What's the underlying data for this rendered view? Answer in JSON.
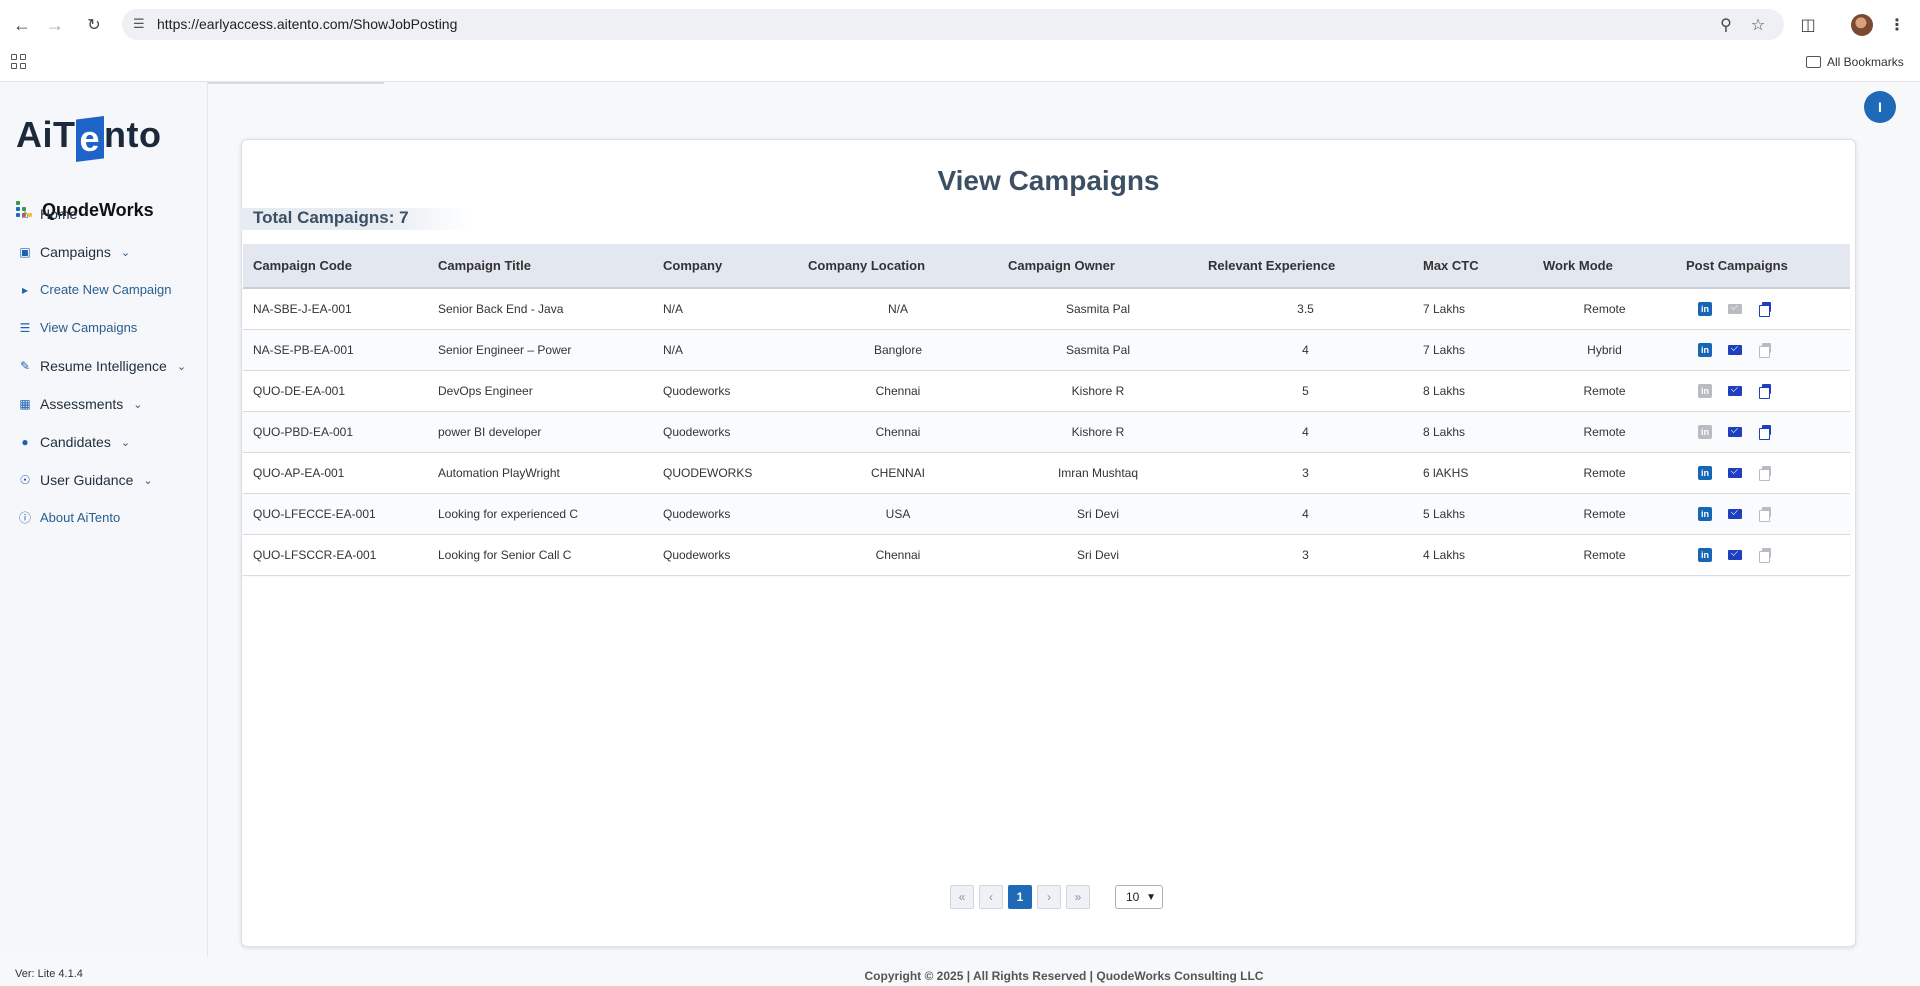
{
  "browser": {
    "url": "https://earlyaccess.aitento.com/ShowJobPosting",
    "bookmarks_label": "All Bookmarks"
  },
  "sidebar": {
    "brand_ai": "AiT",
    "brand_t": "e",
    "brand_rest": "nto",
    "company_logo": "QuodeWorks",
    "items": [
      {
        "label": "Home",
        "icon": "home-icon"
      },
      {
        "label": "Campaigns",
        "icon": "briefcase-icon",
        "expandable": true
      },
      {
        "label": "Create New Campaign",
        "icon": "megaphone-icon",
        "sub": true
      },
      {
        "label": "View Campaigns",
        "icon": "list-icon",
        "sub": true
      },
      {
        "label": "Resume Intelligence",
        "icon": "resume-icon",
        "expandable": true
      },
      {
        "label": "Assessments",
        "icon": "assessment-icon",
        "expandable": true
      },
      {
        "label": "Candidates",
        "icon": "users-icon",
        "expandable": true
      },
      {
        "label": "User Guidance",
        "icon": "bulb-icon",
        "expandable": true
      },
      {
        "label": "About AiTento",
        "icon": "info-icon",
        "sub": true
      }
    ],
    "version": "Ver: Lite 4.1.4"
  },
  "header": {
    "user_initial": "I"
  },
  "main": {
    "title": "View Campaigns",
    "total_label": "Total Campaigns: 7",
    "columns": [
      "Campaign Code",
      "Campaign Title",
      "Company",
      "Company Location",
      "Campaign Owner",
      "Relevant Experience",
      "Max CTC",
      "Work Mode",
      "Post Campaigns"
    ],
    "rows": [
      {
        "code": "NA-SBE-J-EA-001",
        "title": "Senior Back End - Java",
        "company": "N/A",
        "location": "N/A",
        "owner": "Sasmita Pal",
        "experience": "3.5",
        "ctc": "7 Lakhs",
        "mode": "Remote",
        "linkedin": true,
        "mail": false,
        "copy": true
      },
      {
        "code": "NA-SE-PB-EA-001",
        "title": " Senior Engineer – Power",
        "company": "N/A",
        "location": "Banglore",
        "owner": "Sasmita Pal",
        "experience": "4",
        "ctc": "7 Lakhs",
        "mode": "Hybrid",
        "linkedin": true,
        "mail": true,
        "copy": false
      },
      {
        "code": "QUO-DE-EA-001",
        "title": "DevOps Engineer",
        "company": "Quodeworks",
        "location": "Chennai",
        "owner": "Kishore R",
        "experience": "5",
        "ctc": "8 Lakhs",
        "mode": "Remote",
        "linkedin": false,
        "mail": true,
        "copy": true
      },
      {
        "code": "QUO-PBD-EA-001",
        "title": "power BI developer",
        "company": "Quodeworks",
        "location": "Chennai",
        "owner": "Kishore R",
        "experience": "4",
        "ctc": "8 Lakhs",
        "mode": "Remote",
        "linkedin": false,
        "mail": true,
        "copy": true
      },
      {
        "code": "QUO-AP-EA-001",
        "title": "Automation PlayWright",
        "company": "QUODEWORKS",
        "location": "CHENNAI",
        "owner": "Imran Mushtaq",
        "experience": "3",
        "ctc": "6 lAKHS",
        "mode": "Remote",
        "linkedin": true,
        "mail": true,
        "copy": false
      },
      {
        "code": "QUO-LFECCE-EA-001",
        "title": "Looking for experienced C",
        "company": "Quodeworks",
        "location": "USA",
        "owner": "Sri Devi",
        "experience": "4",
        "ctc": "5 Lakhs",
        "mode": "Remote",
        "linkedin": true,
        "mail": true,
        "copy": false
      },
      {
        "code": "QUO-LFSCCR-EA-001",
        "title": "Looking for Senior Call C",
        "company": "Quodeworks",
        "location": "Chennai",
        "owner": "Sri Devi",
        "experience": "3",
        "ctc": "4 Lakhs",
        "mode": "Remote",
        "linkedin": true,
        "mail": true,
        "copy": false
      }
    ]
  },
  "pagination": {
    "first": "«",
    "prev": "‹",
    "current": "1",
    "next": "›",
    "last": "»",
    "page_size": "10"
  },
  "footer": {
    "copyright": "Copyright © 2025 | All Rights Reserved | QuodeWorks Consulting LLC"
  },
  "colors": {
    "accent": "#1e6ab8",
    "linkedin": "#1766b6",
    "mail": "#1e40c0",
    "disabled": "#b8bcc2"
  }
}
